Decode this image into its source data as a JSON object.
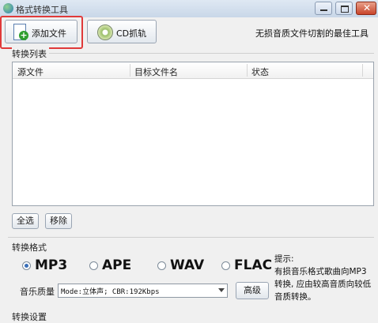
{
  "window": {
    "title": "格式转换工具"
  },
  "toolbar": {
    "add_file_label": "添加文件",
    "cd_rip_label": "CD抓轨",
    "slogan": "无损音质文件切割的最佳工具"
  },
  "conversion_list": {
    "section_label": "转换列表",
    "columns": [
      "源文件",
      "目标文件名",
      "状态"
    ]
  },
  "list_buttons": {
    "select_all": "全选",
    "remove": "移除"
  },
  "format": {
    "section_label": "转换格式",
    "options": [
      "MP3",
      "APE",
      "WAV",
      "FLAC"
    ],
    "selected": "MP3"
  },
  "quality": {
    "label": "音乐质量",
    "value": "Mode:立体声; CBR:192Kbps",
    "advanced_label": "高级"
  },
  "tip": {
    "lines": [
      "提示:",
      "  有损音乐格式歌曲向MP3",
      "转换, 应由较高音质向较低",
      "音质转换。"
    ]
  },
  "settings": {
    "section_label": "转换设置"
  }
}
